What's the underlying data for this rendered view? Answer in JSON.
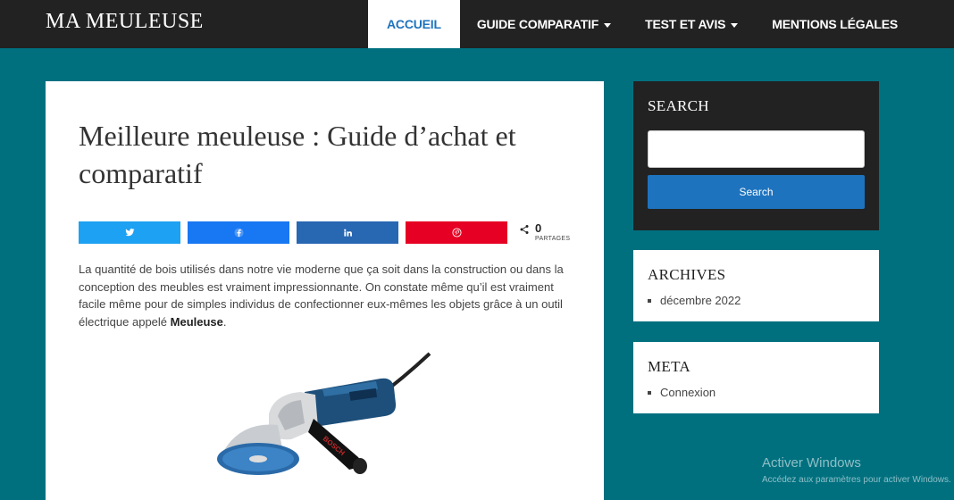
{
  "header": {
    "brand": "MA MEULEUSE",
    "nav": [
      {
        "label": "ACCUEIL",
        "active": true
      },
      {
        "label": "GUIDE COMPARATIF",
        "dropdown": true
      },
      {
        "label": "TEST ET AVIS",
        "dropdown": true
      },
      {
        "label": "MENTIONS LÉGALES"
      }
    ]
  },
  "article": {
    "title": "Meilleure meuleuse : Guide d’achat et comparatif",
    "share": {
      "buttons": [
        {
          "network": "twitter",
          "icon": "twitter-icon",
          "color": "#1da1f2"
        },
        {
          "network": "facebook",
          "icon": "facebook-icon",
          "color": "#1877f2"
        },
        {
          "network": "linkedin",
          "icon": "linkedin-icon",
          "color": "#2867b2"
        },
        {
          "network": "pinterest",
          "icon": "pinterest-icon",
          "color": "#e60023"
        }
      ],
      "count": "0",
      "count_label": "PARTAGES"
    },
    "intro_before": "La quantité de bois utilisés dans notre vie moderne que ça soit dans la construction ou dans la conception des meubles est vraiment impressionnante. On constate même qu’il est vraiment facile même pour de simples individus de confectionner eux-mêmes les objets grâce à un outil électrique appelé ",
    "intro_bold": "Meuleuse",
    "intro_after": "."
  },
  "sidebar": {
    "search": {
      "title": "SEARCH",
      "placeholder": "",
      "button": "Search"
    },
    "archives": {
      "title": "ARCHIVES",
      "items": [
        "décembre 2022"
      ]
    },
    "meta": {
      "title": "META",
      "items": [
        "Connexion"
      ]
    }
  },
  "watermark": {
    "line1": "Activer Windows",
    "line2": "Accédez aux paramètres pour activer Windows."
  },
  "colors": {
    "background": "#00707f",
    "topbar": "#222222",
    "accent": "#1e73be"
  }
}
